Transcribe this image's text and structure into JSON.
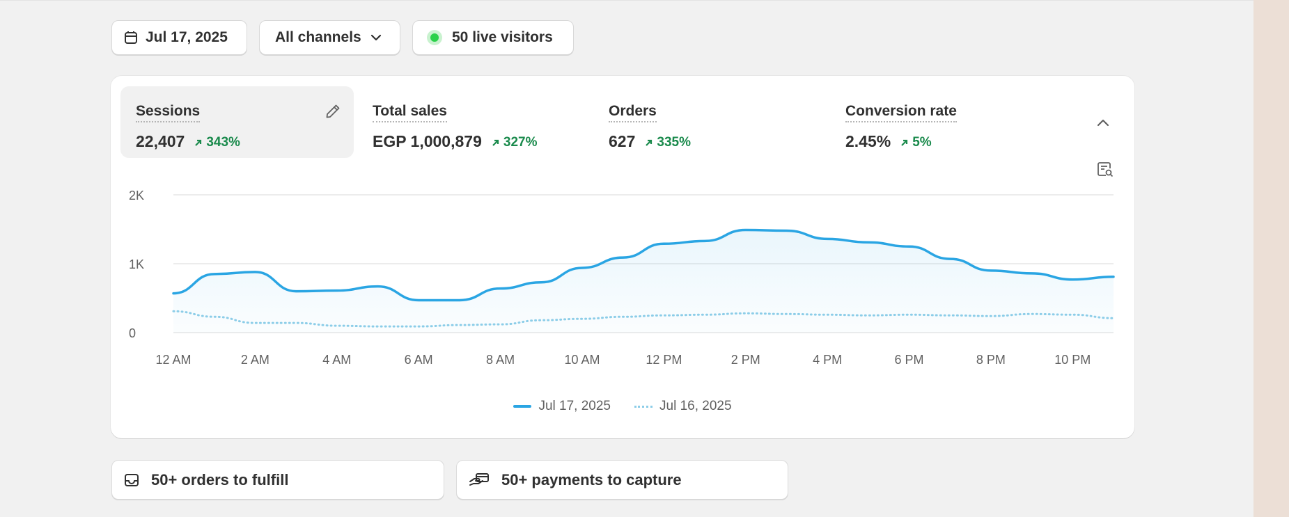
{
  "filters": {
    "date": "Jul 17, 2025",
    "channel": "All channels",
    "live_visitors": "50 live visitors"
  },
  "metrics": [
    {
      "title": "Sessions",
      "value": "22,407",
      "change": "343%",
      "active": true
    },
    {
      "title": "Total sales",
      "value": "EGP 1,000,879",
      "change": "327%"
    },
    {
      "title": "Orders",
      "value": "627",
      "change": "335%"
    },
    {
      "title": "Conversion rate",
      "value": "2.45%",
      "change": "5%"
    }
  ],
  "tasks": {
    "orders": "50+ orders to fulfill",
    "payments": "50+ payments to capture"
  },
  "colors": {
    "accent": "#2aa5e3",
    "comparison": "#8ccde8",
    "positive": "#1a8a4c",
    "live": "#2ad14a"
  },
  "chart_data": {
    "type": "line",
    "x": [
      "12 AM",
      "1 AM",
      "2 AM",
      "3 AM",
      "4 AM",
      "5 AM",
      "6 AM",
      "7 AM",
      "8 AM",
      "9 AM",
      "10 AM",
      "11 AM",
      "12 PM",
      "1 PM",
      "2 PM",
      "3 PM",
      "4 PM",
      "5 PM",
      "6 PM",
      "7 PM",
      "8 PM",
      "9 PM",
      "10 PM",
      "11 PM"
    ],
    "x_tick_labels": [
      "12 AM",
      "2 AM",
      "4 AM",
      "6 AM",
      "8 AM",
      "10 AM",
      "12 PM",
      "2 PM",
      "4 PM",
      "6 PM",
      "8 PM",
      "10 PM"
    ],
    "y_tick_labels": [
      "0",
      "1K",
      "2K"
    ],
    "ylim": [
      0,
      2000
    ],
    "series": [
      {
        "name": "Jul 17, 2025",
        "style": "solid",
        "values": [
          570,
          850,
          880,
          600,
          610,
          670,
          470,
          470,
          640,
          730,
          940,
          1090,
          1290,
          1330,
          1490,
          1480,
          1360,
          1310,
          1250,
          1070,
          900,
          860,
          770,
          810
        ]
      },
      {
        "name": "Jul 16, 2025",
        "style": "dotted",
        "values": [
          310,
          230,
          140,
          140,
          100,
          90,
          90,
          110,
          120,
          180,
          200,
          230,
          250,
          260,
          280,
          270,
          260,
          250,
          260,
          250,
          240,
          270,
          260,
          210
        ]
      }
    ],
    "grid": true,
    "legend": "bottom-center"
  }
}
